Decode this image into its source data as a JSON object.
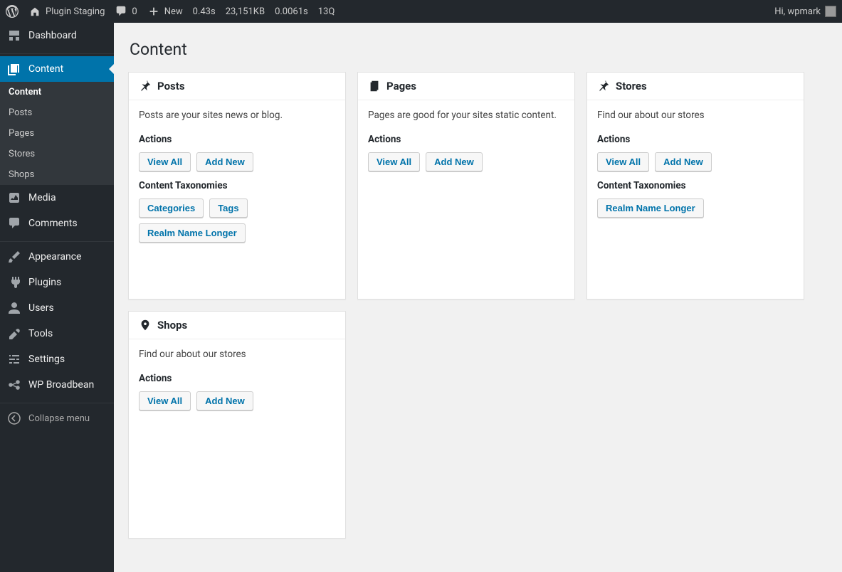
{
  "adminbar": {
    "site_name": "Plugin Staging",
    "comments_count": "0",
    "new_label": "New",
    "metrics": [
      "0.43s",
      "23,151KB",
      "0.0061s",
      "13Q"
    ],
    "greeting": "Hi, wpmark"
  },
  "sidebar": {
    "dashboard": "Dashboard",
    "content": "Content",
    "content_sub": [
      "Content",
      "Posts",
      "Pages",
      "Stores",
      "Shops"
    ],
    "media": "Media",
    "comments": "Comments",
    "appearance": "Appearance",
    "plugins": "Plugins",
    "users": "Users",
    "tools": "Tools",
    "settings": "Settings",
    "wpbroadbean": "WP Broadbean",
    "collapse": "Collapse menu"
  },
  "page": {
    "title": "Content"
  },
  "cards": {
    "posts": {
      "title": "Posts",
      "desc": "Posts are your sites news or blog.",
      "actions_label": "Actions",
      "view_all": "View All",
      "add_new": "Add New",
      "tax_label": "Content Taxonomies",
      "taxonomies": [
        "Categories",
        "Tags",
        "Realm Name Longer"
      ]
    },
    "pages": {
      "title": "Pages",
      "desc": "Pages are good for your sites static content.",
      "actions_label": "Actions",
      "view_all": "View All",
      "add_new": "Add New"
    },
    "stores": {
      "title": "Stores",
      "desc": "Find our about our stores",
      "actions_label": "Actions",
      "view_all": "View All",
      "add_new": "Add New",
      "tax_label": "Content Taxonomies",
      "taxonomies": [
        "Realm Name Longer"
      ]
    },
    "shops": {
      "title": "Shops",
      "desc": "Find our about our stores",
      "actions_label": "Actions",
      "view_all": "View All",
      "add_new": "Add New"
    }
  }
}
